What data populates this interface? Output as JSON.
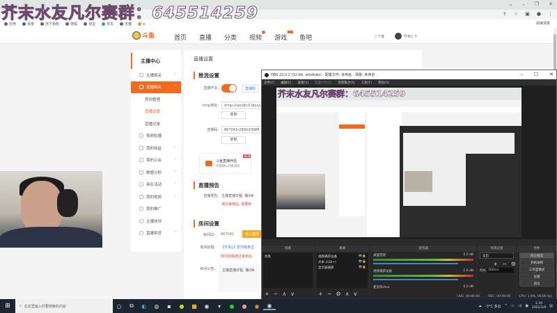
{
  "overlay": {
    "title": "芥末水友凡尔赛群：",
    "number": "645514259"
  },
  "browser": {
    "window_controls": [
      "⌄",
      "–",
      "❐",
      "✕"
    ],
    "toolbar_icons": [
      "share-icon",
      "star-icon",
      "extension-icon",
      "profile-icon",
      "menu-icon"
    ],
    "reading_list": "阅读清单",
    "bookmarks": [
      "应用",
      "百度",
      "苏宁易购",
      "搜狐",
      "淘宝",
      "京东",
      "天猫",
      "a"
    ]
  },
  "douyu": {
    "logo": "斗鱼",
    "logo_sub": "DOUYU.COM",
    "nav": [
      "首页",
      "直播",
      "分类",
      "视频",
      "游戏",
      "鱼吧"
    ],
    "download": "下载",
    "username": "芥末y",
    "sidebar": {
      "header": "主播中心",
      "items": [
        {
          "label": "主播相关",
          "caret": true
        },
        {
          "label": "直播相关",
          "caret": true,
          "active": true
        },
        {
          "label": "房间管理",
          "sub": true
        },
        {
          "label": "直播设置",
          "sub": true,
          "current": true
        },
        {
          "label": "直播记录",
          "sub": true
        },
        {
          "label": "视频轮播"
        },
        {
          "label": "我的收益",
          "caret": true
        },
        {
          "label": "我的公会",
          "caret": true
        },
        {
          "label": "数据分析",
          "caret": true
        },
        {
          "label": "商业活动",
          "caret": true
        },
        {
          "label": "我的视频",
          "caret": true
        },
        {
          "label": "我的推广"
        },
        {
          "label": "主播扶持"
        },
        {
          "label": "直播带货",
          "caret": true
        }
      ]
    },
    "main": {
      "title": "直播设置",
      "push": {
        "title": "推流设置",
        "switch_label": "直播开关:",
        "switch_on": true,
        "switch_link": "直播软",
        "rtmp_label": "rtmp地址:",
        "rtmp_value": "rtmp://sendtc3.douyu",
        "copy": "复制",
        "code_label": "直播码:",
        "code_value": "867041r28Dk2HWM",
        "companion_title": "斗鱼直播伴侣",
        "companion_sub": "仅需填1次播流码",
        "new_badge": "NEW"
      },
      "notice": {
        "title": "直播预告",
        "label": "直播预告:",
        "value": "主播直播日程: 播2休",
        "warn": "通过审核后, 需要用"
      },
      "room": {
        "title": "房间设置",
        "id_label": "房间ID:",
        "id_value": "867041",
        "enter_btn": "进入直播",
        "title_label": "房间标题:",
        "title_value": "【芥末y】爱你我身边",
        "title_warn": "房间标题通过审核后,",
        "announce_label": "房间公告:",
        "announce_value": "主播直播日程: 播2休"
      }
    }
  },
  "obs": {
    "title": "OBS 22.0.2 (32-bit, windows) - 配置文件: 未命名 - 场景: 未命名",
    "menu": [
      "文件(F)",
      "编辑(E)",
      "查看(V)",
      "配置文件(P)",
      "场景集合(S)",
      "工具(T)",
      "帮助(H)"
    ],
    "docks": {
      "scenes": {
        "title": "场景",
        "items": [
          "场景"
        ]
      },
      "sources": {
        "title": "来源",
        "items": [
          "视频捕获设备",
          "文本 (GDI+)",
          "显示器捕获"
        ]
      },
      "mixer": {
        "title": "混音器",
        "channels": [
          {
            "name": "桌面音频",
            "db": "0.0 dB",
            "level": 0.82
          },
          {
            "name": "视频捕获设备",
            "db": "-1.6 dB",
            "level": 0.75
          },
          {
            "name": "麦克风/Aux",
            "db": "0.0 dB",
            "level": 0
          }
        ]
      },
      "transitions": {
        "title": "场景过渡",
        "selected": "淡出",
        "duration_label": "时长",
        "duration": "300ms"
      },
      "controls": {
        "title": "控件",
        "buttons": [
          "停止推流",
          "开始录制",
          "工作室模式",
          "设置",
          "退出"
        ]
      }
    },
    "status": {
      "live": "LIVE: 00:00:00",
      "rec": "REC: 00:00:00",
      "cpu": "CPU: 1.9%, 60.00 fps"
    }
  },
  "taskbar": {
    "search_placeholder": "在这里输入你要搜索的内容",
    "weather": "-3°C 多云",
    "time": "1:30",
    "date": "2022/1/9"
  }
}
